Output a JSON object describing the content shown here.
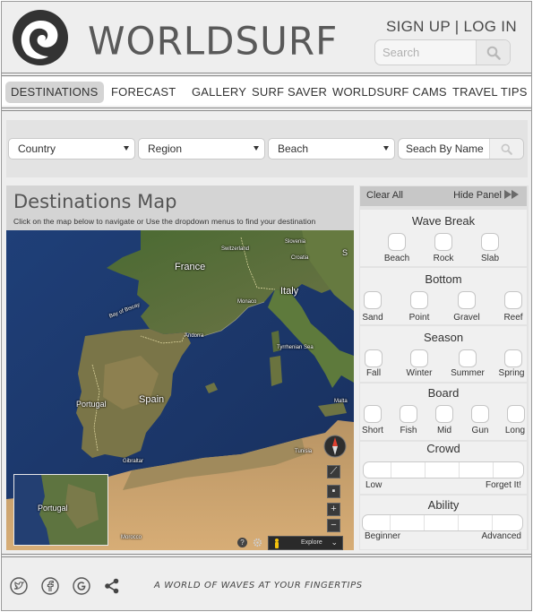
{
  "header": {
    "brand": "WORLDSURF",
    "sign_up": "SIGN UP",
    "separator": "|",
    "log_in": "LOG IN",
    "search_placeholder": "Search"
  },
  "nav": {
    "tabs": [
      {
        "label": "DESTINATIONS",
        "active": true
      },
      {
        "label": "FORECAST"
      },
      {
        "label": "GALLERY"
      },
      {
        "label": "SURF SAVER"
      },
      {
        "label": "WORLDSURF CAMS"
      },
      {
        "label": "TRAVEL TIPS"
      }
    ]
  },
  "filters": {
    "country": "Country",
    "region": "Region",
    "beach": "Beach",
    "name_placeholder": "Seach By Name"
  },
  "map": {
    "title": "Destinations Map",
    "subtitle": "Click on the map below to navigate or Use the dropdown menus to find your destination",
    "labels": {
      "france": "France",
      "spain": "Spain",
      "portugal": "Portugal",
      "italy": "Italy",
      "switzerland": "Switzerland",
      "slovenia": "Slovenia",
      "croatia": "Croatia",
      "monaco": "Monaco",
      "andorra": "Andorra",
      "bay_of_biscay": "Bay of Biscay",
      "tyrrhenian": "Tyrrhenian Sea",
      "malta": "Malta",
      "tunisia": "Tunisia",
      "gibraltar": "Gibraltar",
      "morocco": "Morocco",
      "serbia": "S",
      "inset_portugal": "Portugal"
    },
    "controls": {
      "zoom_in": "+",
      "zoom_out": "−",
      "help": "?",
      "explore": "Explore"
    }
  },
  "panel": {
    "clear_all": "Clear All",
    "hide_panel": "Hide Panel",
    "wave_break": {
      "title": "Wave Break",
      "options": [
        "Beach",
        "Rock",
        "Slab"
      ]
    },
    "bottom": {
      "title": "Bottom",
      "options": [
        "Sand",
        "Point",
        "Gravel",
        "Reef"
      ]
    },
    "season": {
      "title": "Season",
      "options": [
        "Fall",
        "Winter",
        "Summer",
        "Spring"
      ]
    },
    "board": {
      "title": "Board",
      "options": [
        "Short",
        "Fish",
        "Mid",
        "Gun",
        "Long"
      ]
    },
    "crowd": {
      "title": "Crowd",
      "low": "Low",
      "high": "Forget It!"
    },
    "ability": {
      "title": "Ability",
      "low": "Beginner",
      "high": "Advanced"
    }
  },
  "footer": {
    "tagline": "A WORLD OF WAVES AT YOUR FINGERTIPS",
    "social": [
      "twitter-icon",
      "facebook-icon",
      "google-plus-icon",
      "share-icon"
    ]
  }
}
